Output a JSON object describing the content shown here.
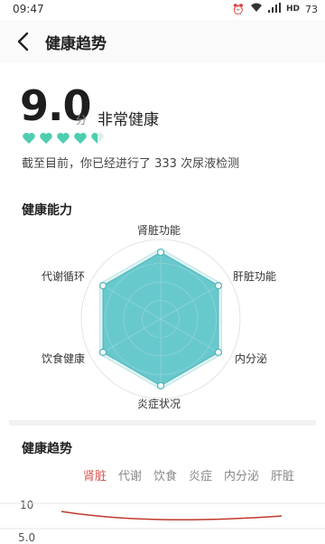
{
  "status_bar": {
    "time": "09:47",
    "battery": "73"
  },
  "header": {
    "title": "健康趋势"
  },
  "score": {
    "value": "9.0",
    "unit": "分",
    "label": "非常健康",
    "hearts_filled": 4.5,
    "hearts_total": 5,
    "caption": "截至目前，你已经进行了 333 次尿液检测",
    "heart_color": "#4ecdb0"
  },
  "ability": {
    "title": "健康能力",
    "labels": [
      "肾脏功能",
      "肝脏功能",
      "内分泌",
      "炎症状况",
      "饮食健康",
      "代谢循环"
    ],
    "fill_color": "#5bc4c9"
  },
  "trend": {
    "title": "健康趋势",
    "tabs": [
      "肾脏",
      "代谢",
      "饮食",
      "炎症",
      "内分泌",
      "肝脏"
    ],
    "active_tab": 0,
    "y_ticks": [
      "10",
      "5.0"
    ],
    "line_color": "#c0392b"
  }
}
